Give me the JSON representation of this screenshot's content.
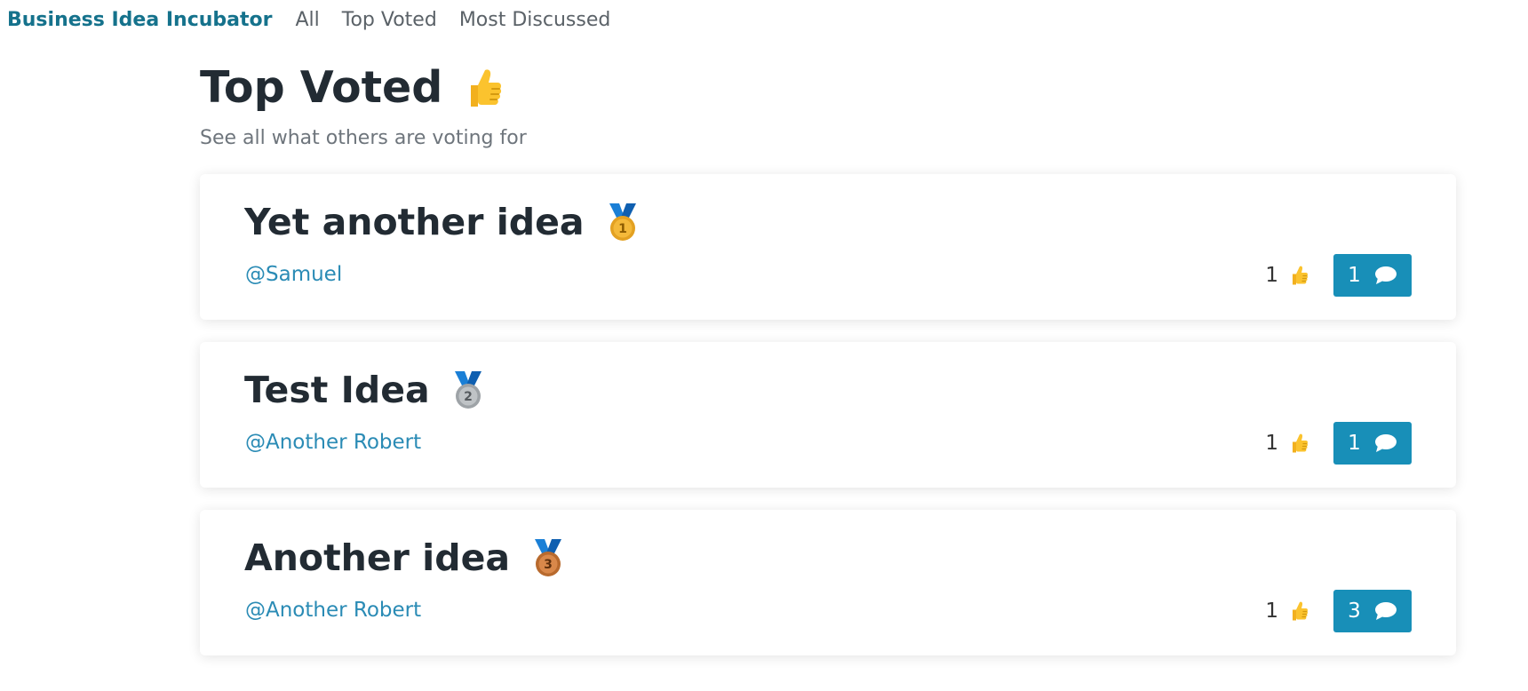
{
  "navbar": {
    "brand": "Business Idea Incubator",
    "links": [
      {
        "label": "All"
      },
      {
        "label": "Top Voted"
      },
      {
        "label": "Most Discussed"
      }
    ]
  },
  "page": {
    "title": "Top Voted",
    "title_icon": "thumbs-up-icon",
    "subtitle": "See all what others are voting for"
  },
  "ideas": [
    {
      "title": "Yet another idea",
      "medal": "gold-medal-icon",
      "medal_number": "1",
      "author": "@Samuel",
      "votes": "1",
      "comments": "1"
    },
    {
      "title": "Test Idea",
      "medal": "silver-medal-icon",
      "medal_number": "2",
      "author": "@Another Robert",
      "votes": "1",
      "comments": "1"
    },
    {
      "title": "Another idea",
      "medal": "bronze-medal-icon",
      "medal_number": "3",
      "author": "@Another Robert",
      "votes": "1",
      "comments": "3"
    }
  ],
  "colors": {
    "brand": "#15728c",
    "link": "#2a8bb5",
    "button": "#188fb8",
    "gold": "#f4b93a",
    "silver": "#bfc3c6",
    "bronze": "#d9884a",
    "ribbon": "#1a7fd6"
  }
}
